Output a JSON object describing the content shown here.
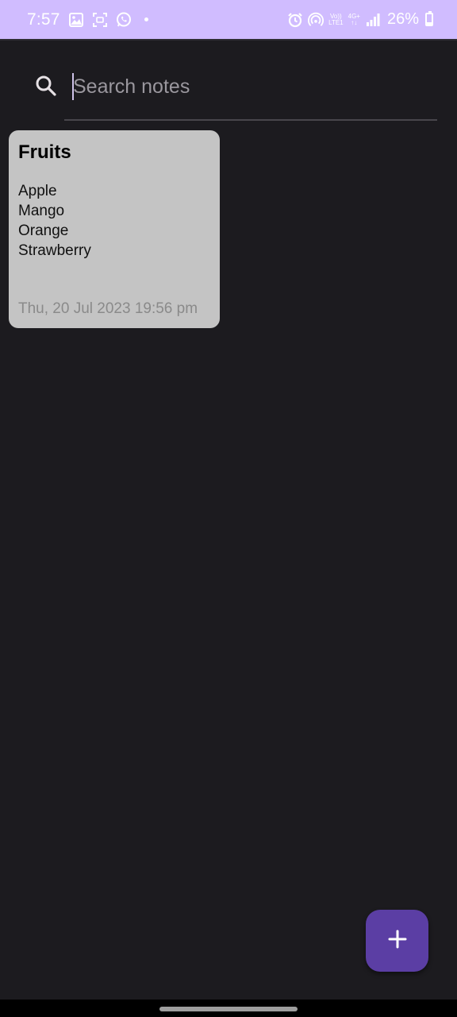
{
  "status_bar": {
    "time": "7:57",
    "network_top": "Vo))",
    "network_bottom": "LTE1",
    "network_type": "4G+",
    "battery": "26%",
    "battery_level": 0.26,
    "background_color": "#d0bcff",
    "left_icons": [
      "image-icon",
      "screenshot-icon",
      "whatsapp-icon",
      "dot-icon"
    ],
    "right_icons": [
      "alarm-icon",
      "hotspot-icon",
      "signal-icon",
      "battery-icon"
    ]
  },
  "search": {
    "placeholder": "Search notes",
    "value": "",
    "icon": "search-icon"
  },
  "notes": [
    {
      "title": "Fruits",
      "lines": [
        "Apple",
        "Mango",
        "Orange",
        "Strawberry"
      ],
      "date": "Thu, 20 Jul 2023 19:56 pm",
      "color": "#c4c4c4"
    }
  ],
  "fab": {
    "icon": "plus-icon",
    "color": "#5b3ea4"
  },
  "colors": {
    "background": "#1c1b1f",
    "accent": "#d0bcff"
  }
}
